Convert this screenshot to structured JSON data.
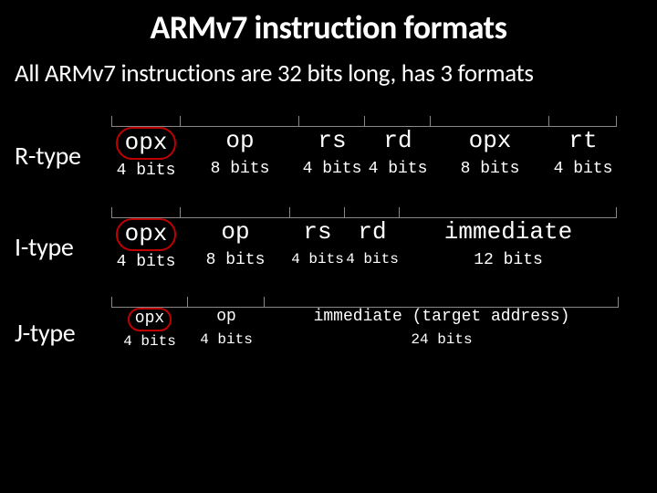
{
  "title": "ARMv7 instruction formats",
  "subtitle": "All ARMv7 instructions are 32 bits long, has 3 formats",
  "r": {
    "label": "R-type",
    "fields": [
      "opx",
      "op",
      "rs",
      "rd",
      "opx",
      "rt"
    ],
    "widths": [
      "4 bits",
      "8 bits",
      "4 bits",
      "4 bits",
      "8 bits",
      "4 bits"
    ]
  },
  "i": {
    "label": "I-type",
    "fields": [
      "opx",
      "op",
      "rs",
      "rd",
      "immediate"
    ],
    "widths": [
      "4 bits",
      "8 bits",
      "4 bits",
      "4 bits",
      "12 bits"
    ]
  },
  "j": {
    "label": "J-type",
    "fields": [
      "opx",
      "op",
      "immediate (target address)"
    ],
    "widths": [
      "4 bits",
      "4 bits",
      "24 bits"
    ]
  }
}
